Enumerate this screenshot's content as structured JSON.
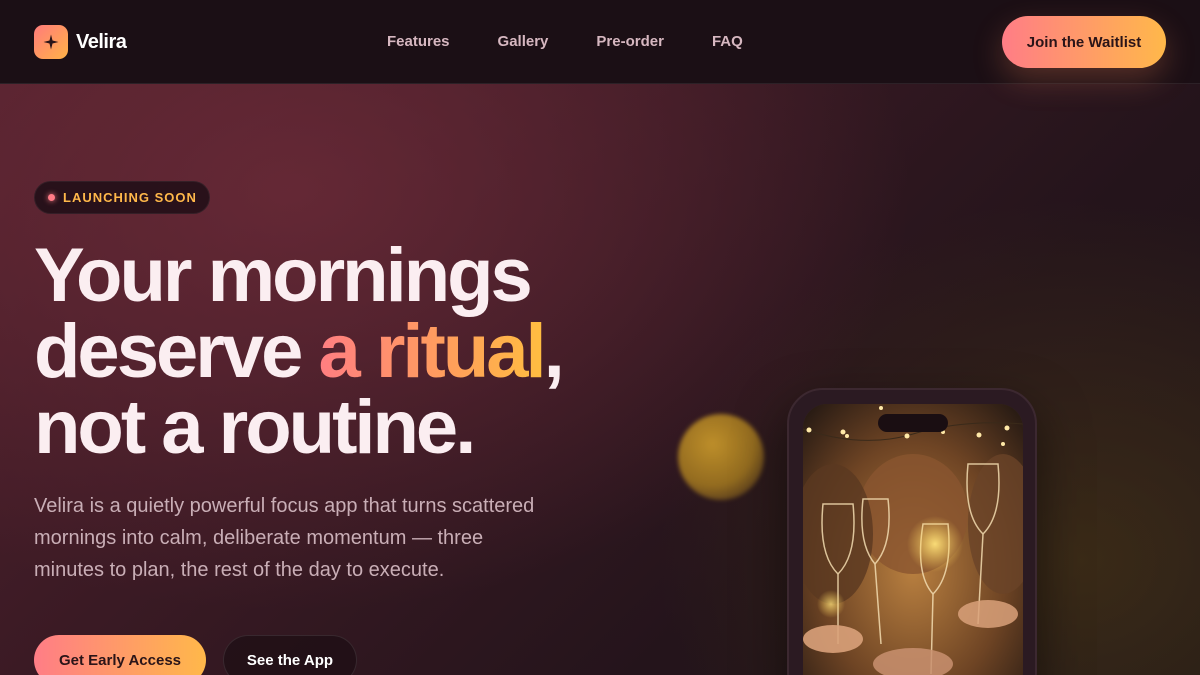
{
  "brand": {
    "name": "Velira",
    "logo_icon": "sparkle-icon"
  },
  "nav": {
    "links": [
      "Features",
      "Gallery",
      "Pre-order",
      "FAQ"
    ],
    "cta_label": "Join the Waitlist"
  },
  "hero": {
    "badge": "LAUNCHING SOON",
    "headline": {
      "line1": "Your mornings",
      "line2_before": "deserve ",
      "line2_accent": "a ritual",
      "line2_after": ",",
      "line3": "not a routine."
    },
    "subtext": "Velira is a quietly powerful focus app that turns scattered mornings into calm, deliberate momentum — three minutes to plan, the rest of the day to execute.",
    "primary_cta": "Get Early Access",
    "secondary_cta": "See the App"
  },
  "colors": {
    "accent_start": "#ff7d86",
    "accent_end": "#ffb84a",
    "nav_bg": "#1b0f15",
    "badge_text": "#ffb84a"
  },
  "phone": {
    "screen_content": "celebration photo with raised wine glasses and string lights"
  }
}
